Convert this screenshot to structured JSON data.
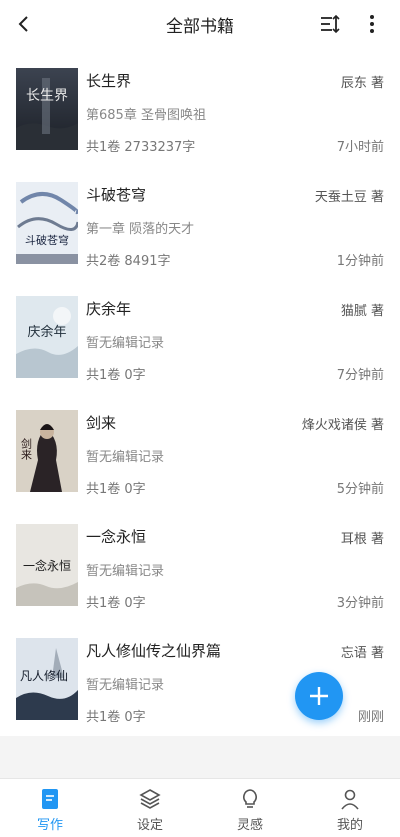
{
  "header": {
    "title": "全部书籍"
  },
  "books": [
    {
      "name": "长生界",
      "author": "辰东 著",
      "chapter": "第685章 圣骨图唤祖",
      "stats": "共1卷 2733237字",
      "time": "7小时前",
      "cover_text": "长生界"
    },
    {
      "name": "斗破苍穹",
      "author": "天蚕土豆 著",
      "chapter": "第一章 陨落的天才",
      "stats": "共2卷 8491字",
      "time": "1分钟前",
      "cover_text": "斗破苍穹"
    },
    {
      "name": "庆余年",
      "author": "猫腻 著",
      "chapter": "暂无编辑记录",
      "stats": "共1卷 0字",
      "time": "7分钟前",
      "cover_text": "庆余年"
    },
    {
      "name": "剑来",
      "author": "烽火戏诸侯 著",
      "chapter": "暂无编辑记录",
      "stats": "共1卷 0字",
      "time": "5分钟前",
      "cover_text": "剑来"
    },
    {
      "name": "一念永恒",
      "author": "耳根 著",
      "chapter": "暂无编辑记录",
      "stats": "共1卷 0字",
      "time": "3分钟前",
      "cover_text": "一念永恒"
    },
    {
      "name": "凡人修仙传之仙界篇",
      "author": "忘语 著",
      "chapter": "暂无编辑记录",
      "stats": "共1卷 0字",
      "time": "刚刚",
      "cover_text": "凡人修仙"
    }
  ],
  "nav": {
    "write": "写作",
    "settings": "设定",
    "inspiration": "灵感",
    "mine": "我的"
  },
  "colors": {
    "accent": "#2196f3"
  }
}
